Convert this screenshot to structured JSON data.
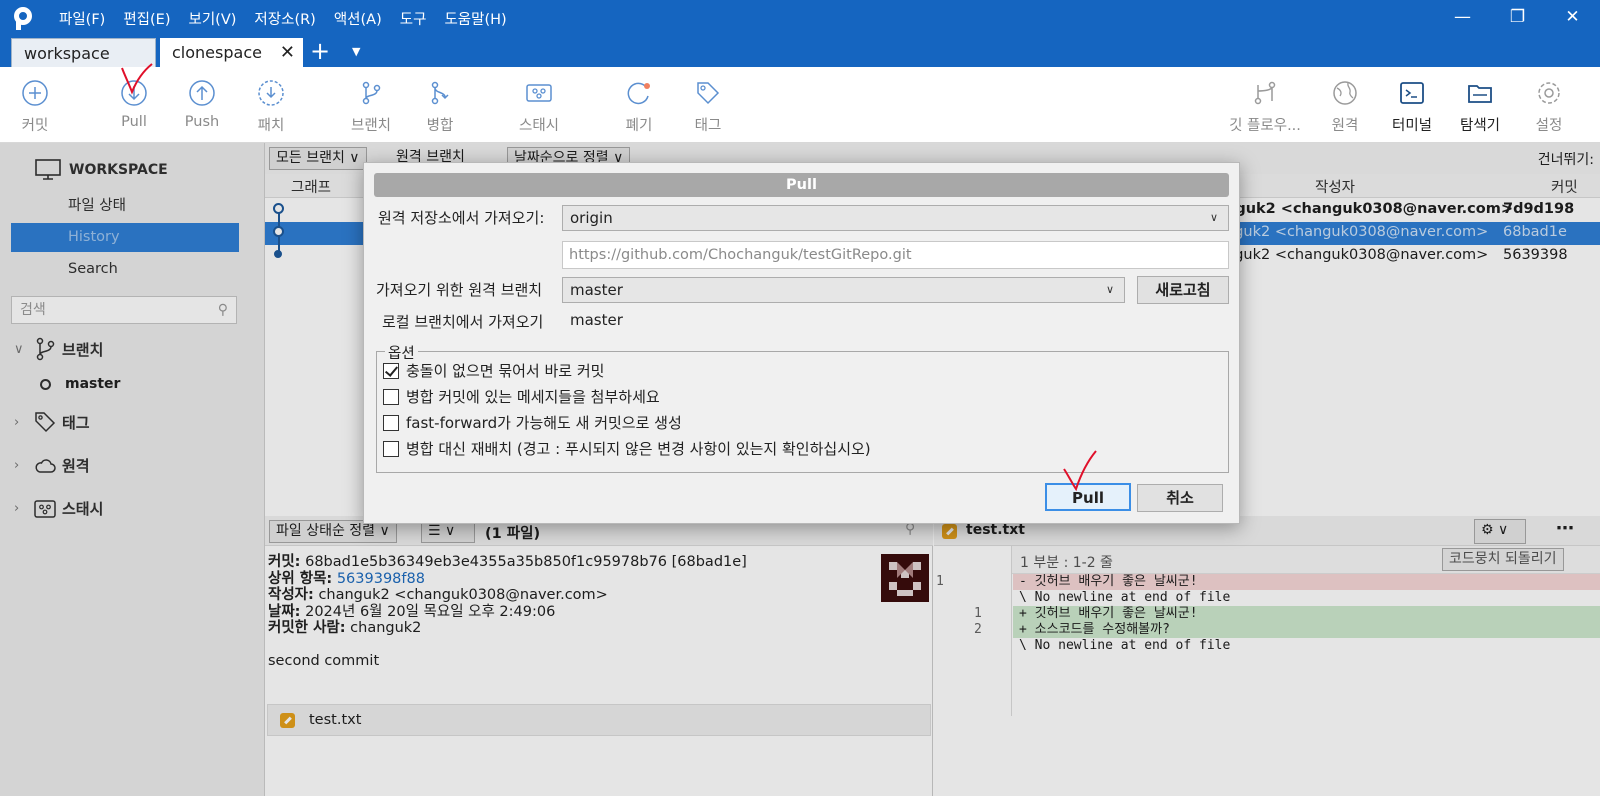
{
  "titlebar": {
    "menu": [
      "파일(F)",
      "편집(E)",
      "보기(V)",
      "저장소(R)",
      "액션(A)",
      "도구",
      "도움말(H)"
    ]
  },
  "tabs": [
    {
      "label": "workspace"
    },
    {
      "label": "clonespace"
    }
  ],
  "toolbar": {
    "commit": "커밋",
    "pull": "Pull",
    "push": "Push",
    "patch": "패치",
    "branch": "브랜치",
    "merge": "병합",
    "stash": "스태시",
    "discard": "폐기",
    "tag": "태그",
    "gitflow": "깃 플로우...",
    "remote": "원격",
    "terminal": "터미널",
    "explorer": "탐색기",
    "settings": "설정"
  },
  "sidebar": {
    "workspace": "WORKSPACE",
    "items": [
      "파일 상태",
      "History",
      "Search"
    ],
    "search_placeholder": "검색",
    "branches": "브랜치",
    "branch_master": "master",
    "tags": "태그",
    "remotes": "원격",
    "stashes": "스태시"
  },
  "history": {
    "filter_branches": "모든 브랜치",
    "filter_remote": "원격 브랜치",
    "filter_sort": "날짜순으로 정렬",
    "skip_label": "건너뛰기:",
    "col_graph": "그래프",
    "col_author": "작성자",
    "col_commit": "커밋",
    "rows": [
      {
        "author": "nguk2 <changuk0308@naver.com>",
        "hash": "7d9d198"
      },
      {
        "author": "nguk2 <changuk0308@naver.com>",
        "hash": "68bad1e"
      },
      {
        "author": "nguk2 <changuk0308@naver.com>",
        "hash": "5639398"
      }
    ]
  },
  "files": {
    "sort_label": "파일 상태순 정렬",
    "count": "(1 파일)",
    "file_name": "test.txt"
  },
  "commit_detail": {
    "commit_label": "커밋:",
    "commit_value": "68bad1e5b36349eb3e4355a35b850f1c95978b76 [68bad1e]",
    "parent_label": "상위 항목:",
    "parent_value": "5639398f88",
    "author_label": "작성자:",
    "author_value": "changuk2 <changuk0308@naver.com>",
    "date_label": "날짜:",
    "date_value": "2024년 6월 20일 목요일 오후 2:49:06",
    "committer_label": "커밋한 사람:",
    "committer_value": "changuk2",
    "message": "second commit"
  },
  "diff": {
    "file_name": "test.txt",
    "hunk_header": "1 부분 : 1-2 줄",
    "revert_hunk": "코드뭉치 되돌리기",
    "lines": [
      {
        "old": "1",
        "new": "",
        "text": "- 깃허브 배우기 좋은 날씨군!"
      },
      {
        "old": "",
        "new": "",
        "text": "\\ No newline at end of file"
      },
      {
        "old": "",
        "new": "1",
        "text": "+ 깃허브 배우기 좋은 날씨군!"
      },
      {
        "old": "",
        "new": "2",
        "text": "+ 소스코드를 수정해볼까?"
      },
      {
        "old": "",
        "new": "",
        "text": "\\ No newline at end of file"
      }
    ]
  },
  "dialog": {
    "title": "Pull",
    "remote_label": "원격 저장소에서 가져오기:",
    "remote_value": "origin",
    "remote_url": "https://github.com/Chochanguk/testGitRepo.git",
    "branch_label": "가져오기 위한 원격 브랜치",
    "branch_value": "master",
    "refresh": "새로고침",
    "local_label": "로컬 브랜치에서 가져오기",
    "local_value": "master",
    "options_title": "옵션",
    "options": [
      {
        "label": "충돌이 없으면 묶어서 바로 커밋",
        "checked": true
      },
      {
        "label": "병합 커밋에 있는 메세지들을 첨부하세요",
        "checked": false
      },
      {
        "label": "fast-forward가 가능해도 새 커밋으로 생성",
        "checked": false
      },
      {
        "label": "병합 대신 재배치 (경고 : 푸시되지 않은 변경 사항이 있는지 확인하십시오)",
        "checked": false
      }
    ],
    "ok": "Pull",
    "cancel": "취소"
  },
  "colors": {
    "titlebar": "#1565c0",
    "selection": "#2f7fd6",
    "annotation": "#e0102a"
  }
}
